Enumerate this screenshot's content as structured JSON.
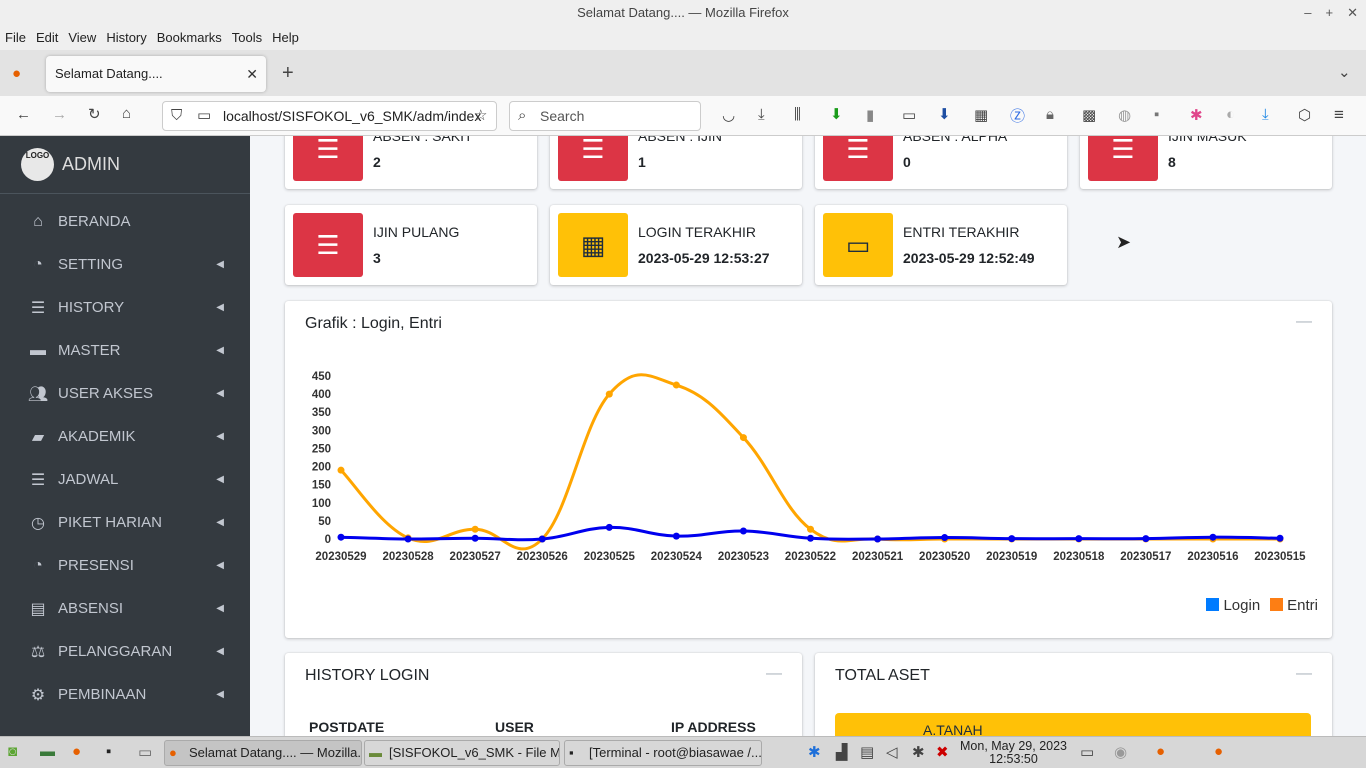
{
  "window": {
    "title": "Selamat Datang.... — Mozilla Firefox"
  },
  "menu": [
    "File",
    "Edit",
    "View",
    "History",
    "Bookmarks",
    "Tools",
    "Help"
  ],
  "tab": {
    "title": "Selamat Datang...."
  },
  "url": "localhost/SISFOKOL_v6_SMK/adm/index",
  "search_placeholder": "Search",
  "sidebar": {
    "brand": "ADMIN",
    "logo_text": "LOGO",
    "items": [
      {
        "label": "BERANDA",
        "icon": "home-icon"
      },
      {
        "label": "SETTING",
        "icon": "dashboard-icon"
      },
      {
        "label": "HISTORY",
        "icon": "list-icon"
      },
      {
        "label": "MASTER",
        "icon": "briefcase-icon"
      },
      {
        "label": "USER AKSES",
        "icon": "users-icon"
      },
      {
        "label": "AKADEMIK",
        "icon": "book-icon"
      },
      {
        "label": "JADWAL",
        "icon": "list-icon"
      },
      {
        "label": "PIKET HARIAN",
        "icon": "clock-icon"
      },
      {
        "label": "PRESENSI",
        "icon": "dashboard-icon"
      },
      {
        "label": "ABSENSI",
        "icon": "newspaper-icon"
      },
      {
        "label": "PELANGGARAN",
        "icon": "scale-icon"
      },
      {
        "label": "PEMBINAAN",
        "icon": "cogs-icon"
      }
    ]
  },
  "info_row1": [
    {
      "label": "ABSEN : SAKIT",
      "value": "2"
    },
    {
      "label": "ABSEN : IJIN",
      "value": "1"
    },
    {
      "label": "ABSEN : ALPHA",
      "value": "0"
    },
    {
      "label": "IJIN MASUK",
      "value": "8"
    }
  ],
  "info_row2": [
    {
      "label": "IJIN PULANG",
      "value": "3"
    },
    {
      "label": "LOGIN TERAKHIR",
      "value": "2023-05-29 12:53:27"
    },
    {
      "label": "ENTRI TERAKHIR",
      "value": "2023-05-29 12:52:49"
    }
  ],
  "chart_card": {
    "title": "Grafik : Login, Entri"
  },
  "chart_data": {
    "type": "line",
    "categories": [
      "20230529",
      "20230528",
      "20230527",
      "20230526",
      "20230525",
      "20230524",
      "20230523",
      "20230522",
      "20230521",
      "20230520",
      "20230519",
      "20230518",
      "20230517",
      "20230516",
      "20230515"
    ],
    "series": [
      {
        "name": "Login",
        "color": "#0000ee",
        "values": [
          5,
          0,
          2,
          0,
          32,
          8,
          22,
          2,
          0,
          4,
          1,
          1,
          1,
          5,
          2
        ]
      },
      {
        "name": "Entri",
        "color": "#ffa500",
        "values": [
          190,
          3,
          27,
          0,
          400,
          425,
          280,
          27,
          0,
          0,
          0,
          0,
          0,
          0,
          0
        ]
      }
    ],
    "yticks": [
      0,
      50,
      100,
      150,
      200,
      250,
      300,
      350,
      400,
      450
    ],
    "ylim": [
      0,
      450
    ],
    "legend": [
      {
        "name": "Login",
        "color": "#007bff"
      },
      {
        "name": "Entri",
        "color": "#fd7e14"
      }
    ],
    "legend_position": "bottom-right"
  },
  "history_login": {
    "title": "HISTORY LOGIN",
    "columns": [
      "POSTDATE",
      "USER",
      "IP ADDRESS"
    ]
  },
  "total_aset": {
    "title": "TOTAL ASET",
    "first_item": "A.TANAH"
  },
  "taskbar": {
    "windows": [
      "Selamat Datang.... — Mozilla...",
      "[SISFOKOL_v6_SMK - File Ma...",
      "[Terminal - root@biasawae /..."
    ],
    "date": "Mon, May 29, 2023",
    "time": "12:53:50"
  }
}
